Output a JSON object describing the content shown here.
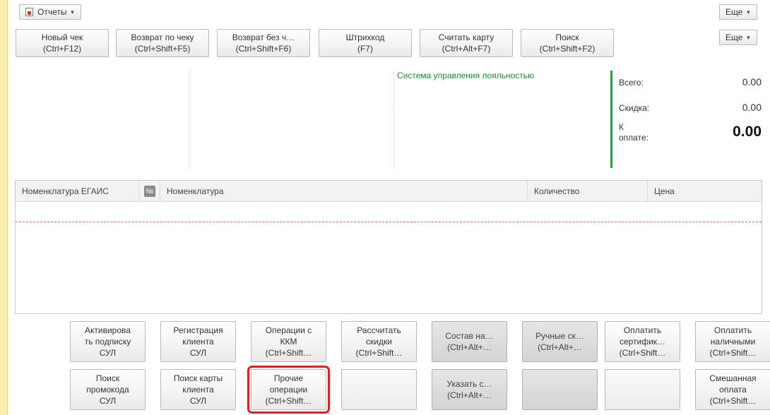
{
  "toolbar": {
    "reports_label": "Отчеты",
    "more_top_label": "Еще",
    "more_second_label": "Еще"
  },
  "actions": [
    {
      "label": "Новый чек\n(Ctrl+F12)"
    },
    {
      "label": "Возврат по чеку\n(Ctrl+Shift+F5)"
    },
    {
      "label": "Возврат без ч…\n(Ctrl+Shift+F6)"
    },
    {
      "label": "Штрихкод\n(F7)"
    },
    {
      "label": "Считать карту\n(Ctrl+Alt+F7)"
    },
    {
      "label": "Поиск\n(Ctrl+Shift+F2)"
    }
  ],
  "loyalty_title": "Система управления лояльностью",
  "totals": {
    "total_label": "Всего:",
    "total_value": "0.00",
    "discount_label": "Скидка:",
    "discount_value": "0.00",
    "topay_label": "К\nоплате:",
    "topay_value": "0.00"
  },
  "table": {
    "columns": [
      "Номенклатура ЕГАИС",
      "№",
      "Номенклатура",
      "Количество",
      "Цена"
    ],
    "rows": []
  },
  "bottom_buttons": {
    "row1": [
      {
        "label": "Активирова\nть подписку\nСУЛ",
        "state": "enabled"
      },
      {
        "label": "Регистрация\nклиента\nСУЛ",
        "state": "enabled"
      },
      {
        "label": "Операции с\nККМ\n(Ctrl+Shift…",
        "state": "enabled"
      },
      {
        "label": "Рассчитать\nскидки\n(Ctrl+Shift…",
        "state": "enabled"
      },
      {
        "label": "Состав на…\n(Ctrl+Alt+…",
        "state": "disabled"
      },
      {
        "label": "Ручные ск…\n(Ctrl+Alt+…",
        "state": "disabled"
      },
      {
        "label": "Оплатить\nсертифик…\n(Ctrl+Shift…",
        "state": "enabled"
      },
      {
        "label": "Оплатить\nналичными\n(Ctrl+Shift…",
        "state": "enabled"
      }
    ],
    "row2": [
      {
        "label": "Поиск\nпромокода\nСУЛ",
        "state": "enabled"
      },
      {
        "label": "Поиск карты\nклиента\nСУЛ",
        "state": "enabled"
      },
      {
        "label": "Прочие\nоперации\n(Ctrl+Shift…",
        "state": "highlighted"
      },
      {
        "label": "",
        "state": "empty"
      },
      {
        "label": "Указать с…\n(Ctrl+Alt+…",
        "state": "disabled"
      },
      {
        "label": "",
        "state": "disabled"
      },
      {
        "label": "",
        "state": "empty"
      },
      {
        "label": "Смешанная\nоплата\n(Ctrl+Shift…",
        "state": "enabled"
      }
    ]
  },
  "colors": {
    "accent_green": "#1b8a3a",
    "highlight_red": "#e0201f",
    "sidebar_yellow": "#fbeeb3"
  }
}
